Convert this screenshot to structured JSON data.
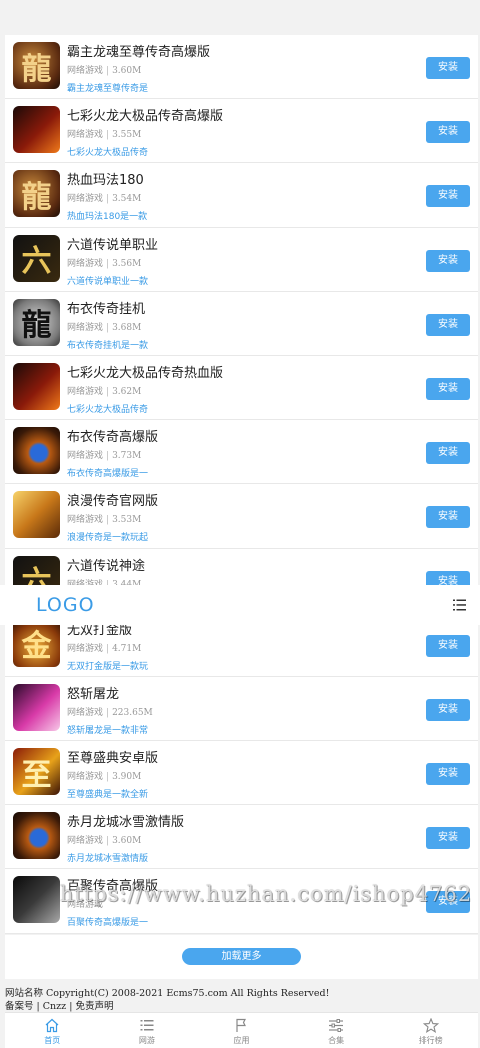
{
  "games": [
    {
      "title": "霸主龙魂至尊传奇高爆版",
      "category": "网络游戏",
      "size": "3.60M",
      "desc": "霸主龙魂至尊传奇是",
      "install": "安装",
      "icon": "dragon-char-icon"
    },
    {
      "title": "七彩火龙大极品传奇高爆版",
      "category": "网络游戏",
      "size": "3.55M",
      "desc": "七彩火龙大极品传奇",
      "install": "安装",
      "icon": "fire-warrior-icon"
    },
    {
      "title": "热血玛法180",
      "category": "网络游戏",
      "size": "3.54M",
      "desc": "热血玛法180是一款",
      "install": "安装",
      "icon": "dragon-char-icon"
    },
    {
      "title": "六道传说单职业",
      "category": "网络游戏",
      "size": "3.56M",
      "desc": "六道传说单职业一款",
      "install": "安装",
      "icon": "gold-calligraphy-icon"
    },
    {
      "title": "布衣传奇挂机",
      "category": "网络游戏",
      "size": "3.68M",
      "desc": "布衣传奇挂机是一款",
      "install": "安装",
      "icon": "stone-dragon-icon"
    },
    {
      "title": "七彩火龙大极品传奇热血版",
      "category": "网络游戏",
      "size": "3.62M",
      "desc": "七彩火龙大极品传奇",
      "install": "安装",
      "icon": "fire-warrior-icon"
    },
    {
      "title": "布衣传奇高爆版",
      "category": "网络游戏",
      "size": "3.73M",
      "desc": "布衣传奇高爆版是一",
      "install": "安装",
      "icon": "blue-orb-dragon-icon"
    },
    {
      "title": "浪漫传奇官网版",
      "category": "网络游戏",
      "size": "3.53M",
      "desc": "浪漫传奇是一款玩起",
      "install": "安装",
      "icon": "golden-sword-icon"
    },
    {
      "title": "六道传说神途",
      "category": "网络游戏",
      "size": "3.44M",
      "desc": "",
      "install": "安装",
      "icon": "gold-calligraphy-icon"
    },
    {
      "title": "无双打金版",
      "category": "网络游戏",
      "size": "4.71M",
      "desc": "无双打金版是一款玩",
      "install": "安装",
      "icon": "gold-coin-icon"
    },
    {
      "title": "怒斩屠龙",
      "category": "网络游戏",
      "size": "223.65M",
      "desc": "怒斩屠龙是一款非常",
      "install": "安装",
      "icon": "pink-sword-icon"
    },
    {
      "title": "至尊盛典安卓版",
      "category": "网络游戏",
      "size": "3.90M",
      "desc": "至尊盛典是一款全新",
      "install": "安装",
      "icon": "gold-crest-icon"
    },
    {
      "title": "赤月龙城冰雪激情版",
      "category": "网络游戏",
      "size": "3.60M",
      "desc": "赤月龙城冰雪激情版",
      "install": "安装",
      "icon": "blue-orb-dragon-icon"
    },
    {
      "title": "百聚传奇高爆版",
      "category": "网络游戏",
      "size": "",
      "desc": "百聚传奇高爆版是一",
      "install": "安装",
      "icon": "dark-warrior-icon"
    }
  ],
  "load_more": "加载更多",
  "header": {
    "logo": "LOGO",
    "menu_icon": "menu-list-icon"
  },
  "watermark": "https://www.huzhan.com/ishop4762",
  "footer": {
    "copyright": "网站名称 Copyright(C) 2008-2021 Ecms75.com All Rights Reserved!",
    "links": [
      "备案号",
      "Cnzz",
      "免责声明"
    ],
    "separator": "|"
  },
  "tabs": [
    {
      "label": "首页",
      "icon": "home-icon",
      "active": true
    },
    {
      "label": "网游",
      "icon": "list-icon",
      "active": false
    },
    {
      "label": "应用",
      "icon": "flag-icon",
      "active": false
    },
    {
      "label": "合集",
      "icon": "sliders-icon",
      "active": false
    },
    {
      "label": "排行榜",
      "icon": "star-icon",
      "active": false
    }
  ],
  "colors": {
    "accent": "#4aa6ee",
    "link": "#3a9be6",
    "background": "#f2f2f2"
  }
}
